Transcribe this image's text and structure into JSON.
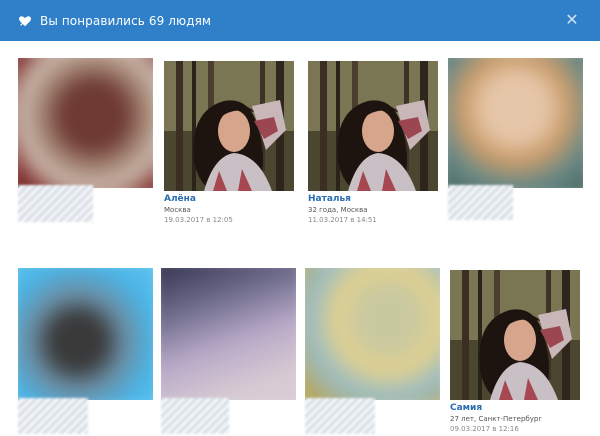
{
  "header": {
    "title": "Вы понравились 69 людям",
    "icon": "heart-icon",
    "close_icon": "close-icon",
    "accent": "#2f80c8"
  },
  "profiles": [
    {
      "visible": false
    },
    {
      "visible": true,
      "name": "Алёна",
      "location": "Москва",
      "date": "19.03.2017 в 12:05"
    },
    {
      "visible": true,
      "name": "Наталья",
      "location": "32 года, Москва",
      "date": "11.03.2017 в 14:51"
    },
    {
      "visible": false
    },
    {
      "visible": false
    },
    {
      "visible": false
    },
    {
      "visible": false
    },
    {
      "visible": true,
      "name": "Самия",
      "location": "27 лет, Санкт-Петербург",
      "date": "09.03.2017 в 12:16"
    }
  ]
}
